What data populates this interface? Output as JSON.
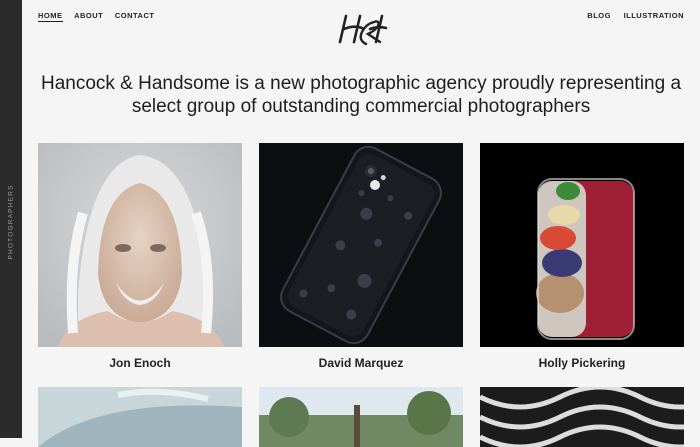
{
  "sidebar": {
    "label": "PHOTOGRAPHERS"
  },
  "nav": {
    "left": [
      "HOME",
      "ABOUT",
      "CONTACT"
    ],
    "right": [
      "BLOG",
      "ILLUSTRATION"
    ]
  },
  "logo": {
    "alt": "H&H"
  },
  "headline": "Hancock & Handsome is a new photographic agency proudly representing a select group of outstanding commercial photographers",
  "photographers": [
    "Jon Enoch",
    "David Marquez",
    "Holly Pickering"
  ]
}
